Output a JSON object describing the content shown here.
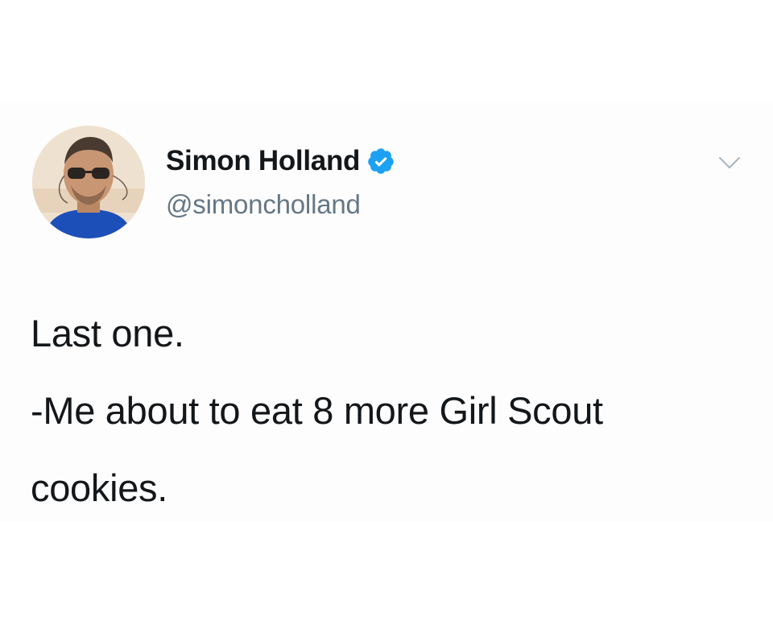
{
  "tweet": {
    "author": {
      "display_name": "Simon Holland",
      "handle": "@simoncholland",
      "verified": true,
      "avatar_icon": "user-avatar-photo"
    },
    "menu_icon": "chevron-down-icon",
    "text_lines": [
      "Last one.",
      "-Me about to eat 8 more Girl Scout",
      "cookies."
    ]
  },
  "colors": {
    "name": "#14171a",
    "handle": "#657786",
    "verified_badge": "#1da1f2",
    "chevron": "#aab8c2",
    "background": "#ffffff"
  }
}
